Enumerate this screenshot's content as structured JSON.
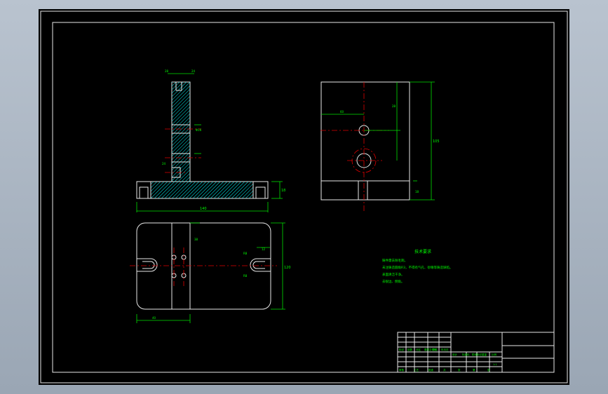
{
  "drawing": {
    "dimensions": {
      "side_height_label": "105",
      "side_top_label": "28",
      "top_left_offset": "60",
      "front_bottom_width": "140",
      "front_base_height": "18",
      "slot_label": "24",
      "hole_label": "Φ16",
      "plan_height": "120",
      "plan_width_bottom": "40",
      "plan_right_label": "R8",
      "plan_mid_label": "12",
      "plan_left_label": "38"
    },
    "tech_req": {
      "title": "技术要求",
      "lines": [
        "铸件需去除毛刺。",
        "未注铸造圆角R3，不得有气孔、砂眼等铸造缺陷。",
        "表面清洁干净。",
        "去锐边、倒角。"
      ]
    },
    "title_block": {
      "row1": [
        "标记",
        "处数",
        "分区",
        "更改文件号",
        "签名",
        "年月日"
      ],
      "row2": [
        "设计",
        "标准化",
        "阶段标记",
        "重量",
        "比例"
      ],
      "row3": [
        "审核",
        "工艺",
        "批准",
        "共",
        "张",
        "第",
        "张"
      ],
      "scale": "1:1"
    }
  }
}
